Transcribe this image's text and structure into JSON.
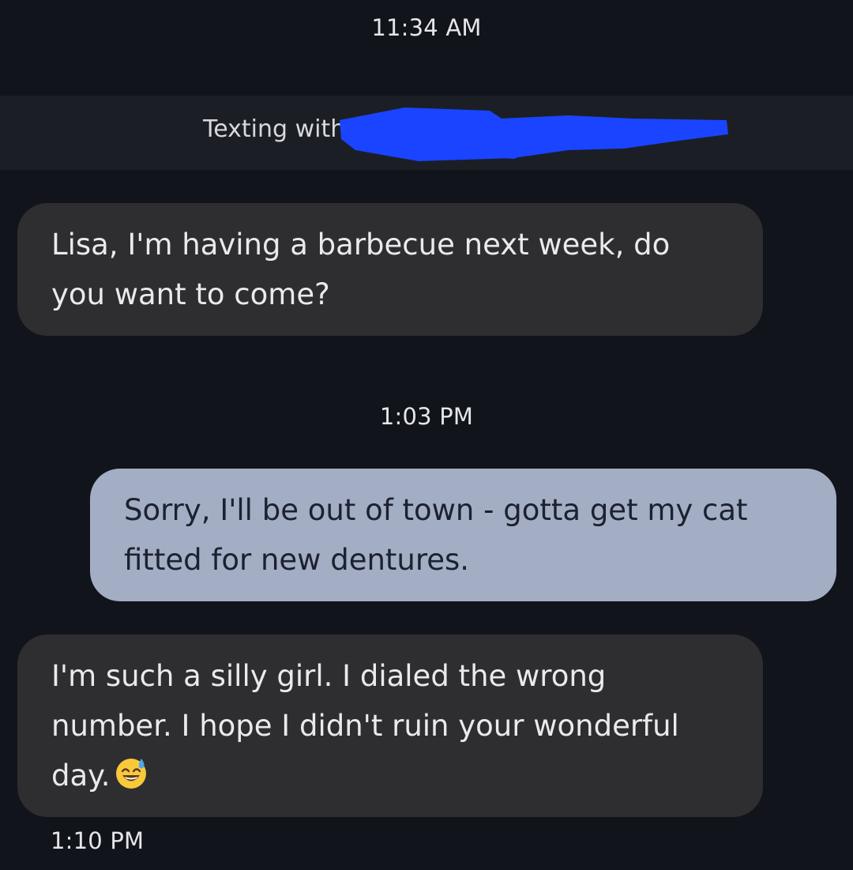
{
  "conversation": {
    "banner_text": "Texting with",
    "messages": [
      {
        "timestamp": "11:34 AM",
        "direction": "incoming",
        "text": "Lisa, I'm having a barbecue next week, do you want to come?"
      },
      {
        "timestamp": "1:03 PM",
        "direction": "outgoing",
        "text": "Sorry, I'll be out of town - gotta get my cat fitted for new dentures."
      },
      {
        "direction": "incoming",
        "text": "I'm such a silly girl. I dialed the wrong number. I hope I didn't ruin your wonderful day.",
        "emoji": "sweat-smile-emoji"
      }
    ],
    "last_timestamp": "1:10 PM"
  },
  "colors": {
    "background": "#11141b",
    "incoming_bubble": "#2e2e31",
    "outgoing_bubble": "#a3adc4",
    "redaction": "#1a44ff"
  }
}
